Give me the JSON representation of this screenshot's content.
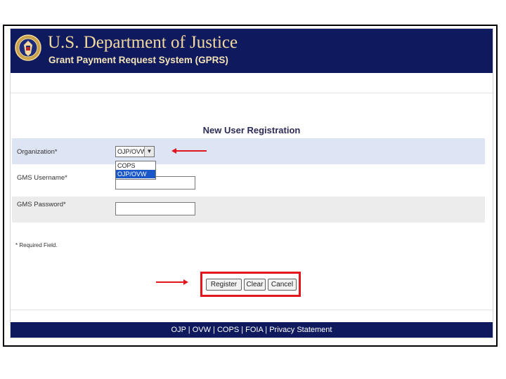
{
  "header": {
    "title": "U.S. Department of Justice",
    "subtitle": "Grant Payment Request System (GPRS)",
    "seal_icon": "doj-seal-icon"
  },
  "form": {
    "title": "New User Registration",
    "organization": {
      "label": "Organization*",
      "selected": "OJP/OVW",
      "options": [
        "COPS",
        "OJP/OVW"
      ],
      "highlighted_option": "OJP/OVW"
    },
    "gms_username": {
      "label": "GMS Username*",
      "value": ""
    },
    "gms_password": {
      "label": "GMS Password*",
      "value": ""
    },
    "required_note": "* Required Field."
  },
  "buttons": {
    "register": "Register",
    "clear": "Clear",
    "cancel": "Cancel"
  },
  "footer": {
    "links": [
      "OJP",
      "OVW",
      "COPS",
      "FOIA",
      "Privacy Statement"
    ],
    "separator": "|"
  },
  "colors": {
    "header_bg": "#0f1a5e",
    "title_text": "#f3d9a0",
    "annotation_red": "#e2141c",
    "row_highlight": "#dde4f3"
  }
}
